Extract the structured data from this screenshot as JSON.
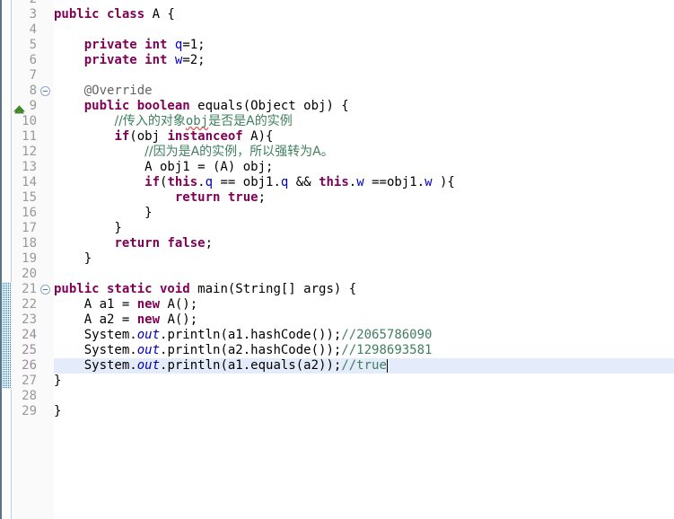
{
  "editor": {
    "type": "java-source-editor",
    "first_visible_line": 2,
    "last_visible_line": 29,
    "current_line": 26,
    "caret_after_text": "//true",
    "colors": {
      "background": "#ffffff",
      "ruler_background": "#fafafa",
      "line_number": "#999999",
      "keyword": "#7f0055",
      "field": "#0000c0",
      "static_field": "#0000c0",
      "comment": "#3f7f5f",
      "annotation": "#646464",
      "current_line_highlight": "#e4ecfb",
      "changed_line_number_highlight": "#ecd9ec",
      "change_bar": "#2a7fc0",
      "error_squiggle": "#e06666",
      "folding_widget": "#7a95b0",
      "override_marker": "#4a9a2f"
    }
  },
  "gutter": {
    "change_blocks": [
      {
        "from_line": 21,
        "to_line": 27
      }
    ],
    "changed_line_numbers": [
      24,
      25,
      26
    ],
    "folding_widgets": [
      {
        "line": 8,
        "state": "collapsible",
        "glyph": "minus-circle"
      },
      {
        "line": 21,
        "state": "collapsible",
        "glyph": "minus-circle"
      }
    ],
    "markers": [
      {
        "line": 9,
        "name": "override-indicator",
        "glyph": "triangle-up",
        "color": "#4a9a2f"
      }
    ]
  },
  "lines": [
    {
      "n": 2,
      "tokens": []
    },
    {
      "n": 3,
      "tokens": [
        {
          "t": "kw",
          "s": "public class "
        },
        {
          "t": "plain",
          "s": "A {"
        }
      ]
    },
    {
      "n": 4,
      "tokens": []
    },
    {
      "n": 5,
      "tokens": [
        {
          "t": "plain",
          "s": "    "
        },
        {
          "t": "kw",
          "s": "private int "
        },
        {
          "t": "fld",
          "s": "q"
        },
        {
          "t": "plain",
          "s": "=1;"
        }
      ]
    },
    {
      "n": 6,
      "tokens": [
        {
          "t": "plain",
          "s": "    "
        },
        {
          "t": "kw",
          "s": "private int "
        },
        {
          "t": "fld",
          "s": "w"
        },
        {
          "t": "plain",
          "s": "=2;"
        }
      ]
    },
    {
      "n": 7,
      "tokens": []
    },
    {
      "n": 8,
      "tokens": [
        {
          "t": "plain",
          "s": "    "
        },
        {
          "t": "ann",
          "s": "@Override"
        }
      ]
    },
    {
      "n": 9,
      "tokens": [
        {
          "t": "plain",
          "s": "    "
        },
        {
          "t": "kw",
          "s": "public boolean "
        },
        {
          "t": "plain",
          "s": "equals(Object obj) {"
        }
      ]
    },
    {
      "n": 10,
      "tokens": [
        {
          "t": "plain",
          "s": "        "
        },
        {
          "t": "cmt",
          "s": "//传入的对象"
        },
        {
          "t": "cmt squiggle",
          "s": "obj"
        },
        {
          "t": "cmt",
          "s": "是否是A的实例"
        }
      ]
    },
    {
      "n": 11,
      "tokens": [
        {
          "t": "plain",
          "s": "        "
        },
        {
          "t": "kw",
          "s": "if"
        },
        {
          "t": "plain",
          "s": "(obj "
        },
        {
          "t": "kw",
          "s": "instanceof"
        },
        {
          "t": "plain",
          "s": " A){"
        }
      ]
    },
    {
      "n": 12,
      "tokens": [
        {
          "t": "plain",
          "s": "            "
        },
        {
          "t": "cmt",
          "s": "//因为是A的实例，所以强转为A。"
        }
      ]
    },
    {
      "n": 13,
      "tokens": [
        {
          "t": "plain",
          "s": "            A obj1 = (A) obj;"
        }
      ]
    },
    {
      "n": 14,
      "tokens": [
        {
          "t": "plain",
          "s": "            "
        },
        {
          "t": "kw",
          "s": "if"
        },
        {
          "t": "plain",
          "s": "("
        },
        {
          "t": "kw",
          "s": "this"
        },
        {
          "t": "plain",
          "s": "."
        },
        {
          "t": "fld",
          "s": "q"
        },
        {
          "t": "plain",
          "s": " == obj1."
        },
        {
          "t": "fld",
          "s": "q"
        },
        {
          "t": "plain",
          "s": " && "
        },
        {
          "t": "kw",
          "s": "this"
        },
        {
          "t": "plain",
          "s": "."
        },
        {
          "t": "fld",
          "s": "w"
        },
        {
          "t": "plain",
          "s": " ==obj1."
        },
        {
          "t": "fld",
          "s": "w"
        },
        {
          "t": "plain",
          "s": " ){"
        }
      ]
    },
    {
      "n": 15,
      "tokens": [
        {
          "t": "plain",
          "s": "                "
        },
        {
          "t": "kw",
          "s": "return true"
        },
        {
          "t": "plain",
          "s": ";"
        }
      ]
    },
    {
      "n": 16,
      "tokens": [
        {
          "t": "plain",
          "s": "            }"
        }
      ]
    },
    {
      "n": 17,
      "tokens": [
        {
          "t": "plain",
          "s": "        }"
        }
      ]
    },
    {
      "n": 18,
      "tokens": [
        {
          "t": "plain",
          "s": "        "
        },
        {
          "t": "kw",
          "s": "return false"
        },
        {
          "t": "plain",
          "s": ";"
        }
      ]
    },
    {
      "n": 19,
      "tokens": [
        {
          "t": "plain",
          "s": "    }"
        }
      ]
    },
    {
      "n": 20,
      "tokens": []
    },
    {
      "n": 21,
      "tokens": [
        {
          "t": "kw",
          "s": "public static void "
        },
        {
          "t": "plain",
          "s": "main(String[] args) {"
        }
      ]
    },
    {
      "n": 22,
      "tokens": [
        {
          "t": "plain",
          "s": "    A a1 = "
        },
        {
          "t": "kw",
          "s": "new"
        },
        {
          "t": "plain",
          "s": " A();"
        }
      ]
    },
    {
      "n": 23,
      "tokens": [
        {
          "t": "plain",
          "s": "    A a2 = "
        },
        {
          "t": "kw",
          "s": "new"
        },
        {
          "t": "plain",
          "s": " A();"
        }
      ]
    },
    {
      "n": 24,
      "tokens": [
        {
          "t": "plain",
          "s": "    System."
        },
        {
          "t": "sfld",
          "s": "out"
        },
        {
          "t": "plain",
          "s": ".println(a1.hashCode());"
        },
        {
          "t": "cmt",
          "s": "//2065786090"
        }
      ]
    },
    {
      "n": 25,
      "tokens": [
        {
          "t": "plain",
          "s": "    System."
        },
        {
          "t": "sfld",
          "s": "out"
        },
        {
          "t": "plain",
          "s": ".println(a2.hashCode());"
        },
        {
          "t": "cmt",
          "s": "//1298693581"
        }
      ]
    },
    {
      "n": 26,
      "tokens": [
        {
          "t": "plain",
          "s": "    System."
        },
        {
          "t": "sfld",
          "s": "out"
        },
        {
          "t": "plain",
          "s": ".println(a1.equals(a2));"
        },
        {
          "t": "cmt",
          "s": "//true"
        }
      ]
    },
    {
      "n": 27,
      "tokens": [
        {
          "t": "plain",
          "s": "}"
        }
      ]
    },
    {
      "n": 28,
      "tokens": []
    },
    {
      "n": 29,
      "tokens": [
        {
          "t": "plain",
          "s": "}"
        }
      ]
    }
  ]
}
